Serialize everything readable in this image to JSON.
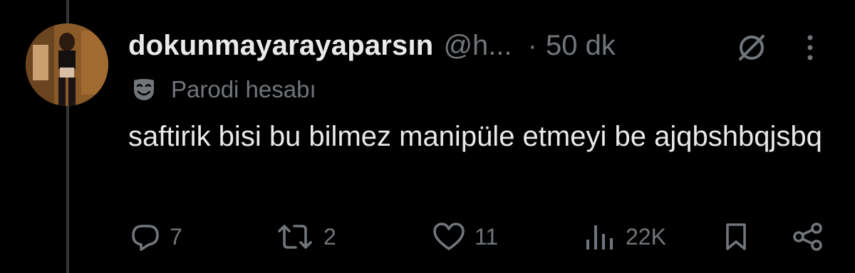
{
  "tweet": {
    "display_name": "dokunmayarayaparsın",
    "handle": "@h...",
    "separator": "·",
    "time": "50 dk",
    "account_label": "Parodi hesabı",
    "text": "saftirik bisi bu bilmez manipüle etmeyi be ajqbshbqjsbq"
  },
  "actions": {
    "replies": "7",
    "reposts": "2",
    "likes": "11",
    "views": "22K"
  },
  "icons": {
    "header": [
      "grok-icon",
      "more-icon"
    ],
    "label": "parody-mask-icon",
    "actions": [
      "reply-icon",
      "repost-icon",
      "like-icon",
      "views-icon",
      "bookmark-icon",
      "share-icon"
    ]
  },
  "colors": {
    "background": "#000000",
    "primary_text": "#e7e9ea",
    "secondary_text": "#71767b",
    "thread_line": "#333639"
  }
}
